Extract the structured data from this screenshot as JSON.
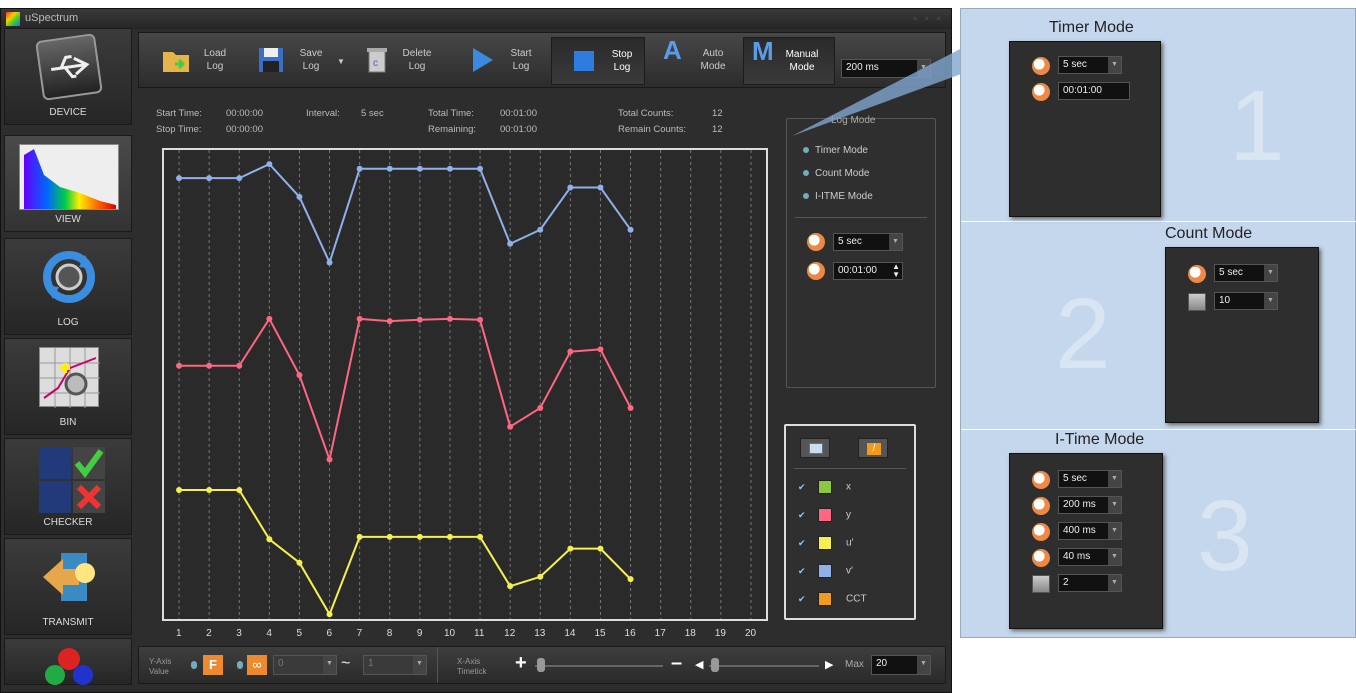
{
  "window": {
    "title": "uSpectrum",
    "controls": "▫ ▫ ▫"
  },
  "sidebar": {
    "items": [
      {
        "label": "DEVICE"
      },
      {
        "label": "VIEW"
      },
      {
        "label": "LOG"
      },
      {
        "label": "BIN"
      },
      {
        "label": "CHECKER"
      },
      {
        "label": "TRANSMIT"
      }
    ]
  },
  "toolbar": {
    "load": [
      "Load",
      "Log"
    ],
    "save": [
      "Save",
      "Log"
    ],
    "del": [
      "Delete",
      "Log"
    ],
    "start": [
      "Start",
      "Log"
    ],
    "stop": [
      "Stop",
      "Log"
    ],
    "auto": [
      "Auto",
      "Mode"
    ],
    "manual": [
      "Manual",
      "Mode"
    ],
    "auto_letter": "A",
    "manual_letter": "M",
    "integration": "200 ms"
  },
  "status": {
    "start_label": "Start Time:",
    "start_val": "00:00:00",
    "stop_label": "Stop Time:",
    "stop_val": "00:00:00",
    "interval_label": "Interval:",
    "interval_val": "5 sec",
    "total_label": "Total Time:",
    "total_val": "00:01:00",
    "remaining_label": "Remaining:",
    "remaining_val": "00:01:00",
    "counts_label": "Total Counts:",
    "counts_val": "12",
    "remain_counts_label": "Remain Counts:",
    "remain_counts_val": "12"
  },
  "log_mode": {
    "title": "Log Mode",
    "options": [
      "Timer Mode",
      "Count Mode",
      "I-ITME Mode"
    ],
    "interval": "5 sec",
    "duration": "00:01:00"
  },
  "legend": {
    "items": [
      {
        "label": "x",
        "color": "#8dc63f"
      },
      {
        "label": "y",
        "color": "#ff6680"
      },
      {
        "label": "u'",
        "color": "#f5f050"
      },
      {
        "label": "v'",
        "color": "#8fb0e8"
      },
      {
        "label": "CCT",
        "color": "#f29a1e"
      }
    ]
  },
  "bottom": {
    "yaxis_label": [
      "Y-Axis",
      "Value"
    ],
    "f_btn": "F",
    "inf_btn": "∞",
    "min_val": "0",
    "tilde": "~",
    "max_val": "1",
    "xaxis_label": [
      "X-Axis",
      "Timetick"
    ],
    "plus": "+",
    "minus": "–",
    "max_label": "Max",
    "max_input": "20"
  },
  "chart_data": {
    "type": "line",
    "x": [
      1,
      2,
      3,
      4,
      5,
      6,
      7,
      8,
      9,
      10,
      11,
      12,
      13,
      14,
      15,
      16
    ],
    "x_ticks": [
      "1",
      "2",
      "3",
      "4",
      "5",
      "6",
      "7",
      "8",
      "9",
      "10",
      "11",
      "12",
      "13",
      "14",
      "15",
      "16",
      "17",
      "18",
      "19",
      "20"
    ],
    "xlim": [
      0.5,
      20.5
    ],
    "ylim": [
      0,
      100
    ],
    "grid": "vertical-dashed",
    "series": [
      {
        "name": "v'",
        "color": "#8fb0e8",
        "values": [
          94,
          94,
          94,
          97,
          90,
          76,
          96,
          96,
          96,
          96,
          96,
          80,
          83,
          92,
          92,
          83
        ]
      },
      {
        "name": "y",
        "color": "#ff6680",
        "values": [
          54,
          54,
          54,
          64,
          52,
          34,
          64,
          63.5,
          63.8,
          64,
          63.8,
          41,
          45,
          57,
          57.5,
          45
        ]
      },
      {
        "name": "u'",
        "color": "#f5f050",
        "values": [
          27.5,
          27.5,
          27.5,
          17,
          12,
          1,
          17.5,
          17.5,
          17.5,
          17.5,
          17.5,
          7,
          9,
          15,
          15,
          8.5
        ]
      }
    ]
  },
  "overlay": {
    "timer": {
      "title": "Timer Mode",
      "number": "1",
      "interval": "5 sec",
      "duration": "00:01:00"
    },
    "count": {
      "title": "Count Mode",
      "number": "2",
      "interval": "5 sec",
      "count": "10"
    },
    "itime": {
      "title": "I-Time Mode",
      "number": "3",
      "values": [
        "5 sec",
        "200 ms",
        "400 ms",
        "40 ms",
        "2"
      ]
    }
  }
}
